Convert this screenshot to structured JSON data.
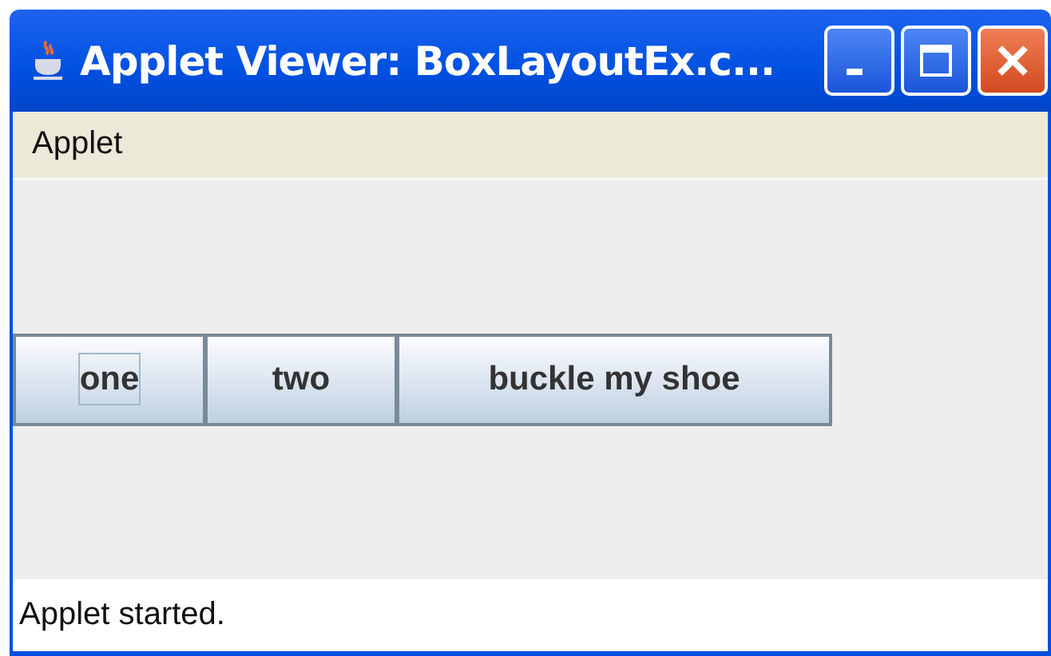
{
  "window": {
    "title": "Applet Viewer: BoxLayoutEx.c..."
  },
  "menu_bar": {
    "items": [
      "Applet"
    ]
  },
  "buttons": [
    {
      "label": "one",
      "focused": true
    },
    {
      "label": "two",
      "focused": false
    },
    {
      "label": "buckle my shoe",
      "focused": false
    }
  ],
  "status_bar": "Applet started."
}
